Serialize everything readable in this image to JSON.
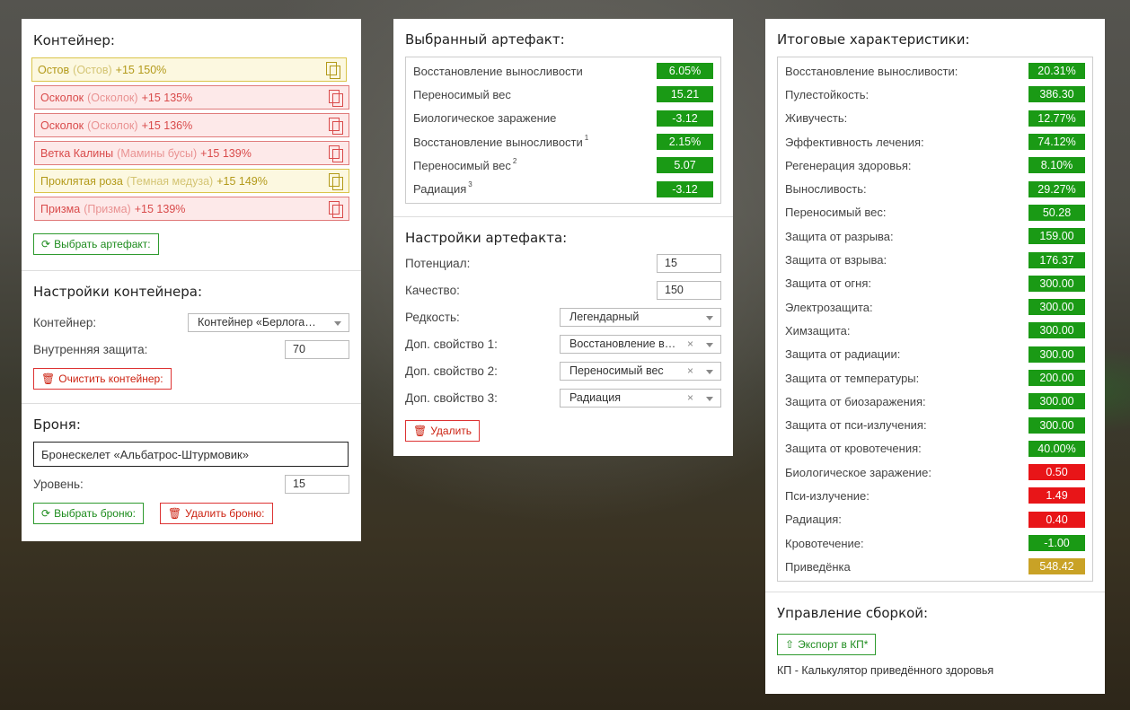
{
  "left": {
    "container_heading": "Контейнер:",
    "artifacts": [
      {
        "name": "Остов",
        "sub": "(Остов)",
        "level": "+15 150%",
        "color": "yellow"
      },
      {
        "name": "Осколок",
        "sub": "(Осколок)",
        "level": "+15 135%",
        "color": "red"
      },
      {
        "name": "Осколок",
        "sub": "(Осколок)",
        "level": "+15 136%",
        "color": "red"
      },
      {
        "name": "Ветка Калины",
        "sub": "(Мамины бусы)",
        "level": "+15 139%",
        "color": "red"
      },
      {
        "name": "Проклятая роза",
        "sub": "(Темная медуза)",
        "level": "+15 149%",
        "color": "yellow"
      },
      {
        "name": "Призма",
        "sub": "(Призма)",
        "level": "+15 139%",
        "color": "red"
      }
    ],
    "choose_artifact": "Выбрать артефакт:",
    "container_settings_heading": "Настройки контейнера:",
    "container_label": "Контейнер:",
    "container_value": "Контейнер «Берлога…",
    "inner_protection_label": "Внутренняя защита:",
    "inner_protection_value": "70",
    "clear_container": "Очистить контейнер:",
    "armor_heading": "Броня:",
    "armor_value": "Бронескелет «Альбатрос-Штурмовик»",
    "level_label": "Уровень:",
    "level_value": "15",
    "choose_armor": "Выбрать броню:",
    "delete_armor": "Удалить броню:"
  },
  "middle": {
    "selected_heading": "Выбранный артефакт:",
    "selected_stats": [
      {
        "label": "Восстановление выносливости",
        "sup": "",
        "value": "6.05%",
        "color": "g"
      },
      {
        "label": "Переносимый вес",
        "sup": "",
        "value": "15.21",
        "color": "g"
      },
      {
        "label": "Биологическое заражение",
        "sup": "",
        "value": "-3.12",
        "color": "g"
      },
      {
        "label": "Восстановление выносливости",
        "sup": "1",
        "value": "2.15%",
        "color": "g"
      },
      {
        "label": "Переносимый вес",
        "sup": "2",
        "value": "5.07",
        "color": "g"
      },
      {
        "label": "Радиация",
        "sup": "3",
        "value": "-3.12",
        "color": "g"
      }
    ],
    "settings_heading": "Настройки артефакта:",
    "potential_label": "Потенциал:",
    "potential_value": "15",
    "quality_label": "Качество:",
    "quality_value": "150",
    "rarity_label": "Редкость:",
    "rarity_value": "Легендарный",
    "prop1_label": "Доп. свойство 1:",
    "prop1_value": "Восстановление в…",
    "prop2_label": "Доп. свойство 2:",
    "prop2_value": "Переносимый вес",
    "prop3_label": "Доп. свойство 3:",
    "prop3_value": "Радиация",
    "delete": "Удалить"
  },
  "right": {
    "totals_heading": "Итоговые характеристики:",
    "totals": [
      {
        "label": "Восстановление выносливости:",
        "value": "20.31%",
        "color": "g"
      },
      {
        "label": "Пулестойкость:",
        "value": "386.30",
        "color": "g"
      },
      {
        "label": "Живучесть:",
        "value": "12.77%",
        "color": "g"
      },
      {
        "label": "Эффективность лечения:",
        "value": "74.12%",
        "color": "g"
      },
      {
        "label": "Регенерация здоровья:",
        "value": "8.10%",
        "color": "g"
      },
      {
        "label": "Выносливость:",
        "value": "29.27%",
        "color": "g"
      },
      {
        "label": "Переносимый вес:",
        "value": "50.28",
        "color": "g"
      },
      {
        "label": "Защита от разрыва:",
        "value": "159.00",
        "color": "g"
      },
      {
        "label": "Защита от взрыва:",
        "value": "176.37",
        "color": "g"
      },
      {
        "label": "Защита от огня:",
        "value": "300.00",
        "color": "g"
      },
      {
        "label": "Электрозащита:",
        "value": "300.00",
        "color": "g"
      },
      {
        "label": "Химзащита:",
        "value": "300.00",
        "color": "g"
      },
      {
        "label": "Защита от радиации:",
        "value": "300.00",
        "color": "g"
      },
      {
        "label": "Защита от температуры:",
        "value": "200.00",
        "color": "g"
      },
      {
        "label": "Защита от биозаражения:",
        "value": "300.00",
        "color": "g"
      },
      {
        "label": "Защита от пси-излучения:",
        "value": "300.00",
        "color": "g"
      },
      {
        "label": "Защита от кровотечения:",
        "value": "40.00%",
        "color": "g"
      },
      {
        "label": "Биологическое заражение:",
        "value": "0.50",
        "color": "r"
      },
      {
        "label": "Пси-излучение:",
        "value": "1.49",
        "color": "r"
      },
      {
        "label": "Радиация:",
        "value": "0.40",
        "color": "r"
      },
      {
        "label": "Кровотечение:",
        "value": "-1.00",
        "color": "g"
      },
      {
        "label": "Приведёнка",
        "value": "548.42",
        "color": "y"
      }
    ],
    "build_heading": "Управление сборкой:",
    "export": "Экспорт в КП*",
    "footnote": "КП - Калькулятор приведённого здоровья"
  }
}
